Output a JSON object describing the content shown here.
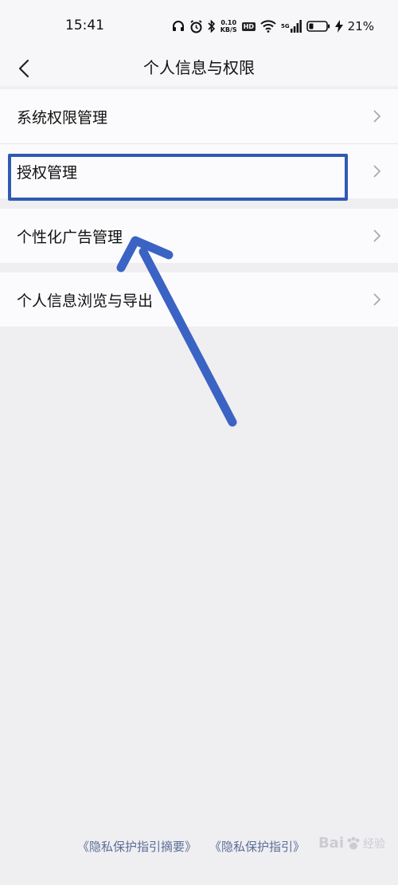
{
  "status_bar": {
    "time": "15:41",
    "net_speed_value": "0.10",
    "net_speed_unit": "KB/S",
    "hd_label": "HD",
    "signal_label": "5G",
    "battery_percent": "21%"
  },
  "nav": {
    "title": "个人信息与权限"
  },
  "list": {
    "items": [
      {
        "label": "系统权限管理"
      },
      {
        "label": "授权管理"
      },
      {
        "label": "个性化广告管理"
      },
      {
        "label": "个人信息浏览与导出"
      }
    ]
  },
  "footer": {
    "link_summary": "《隐私保护指引摘要》",
    "link_guide": "《隐私保护指引》"
  },
  "watermark": {
    "text": "Bai",
    "sub": "经验"
  },
  "colors": {
    "annotation_blue": "#2f5ab2",
    "footer_link": "#5a6f97",
    "page_bg": "#efeef1"
  }
}
